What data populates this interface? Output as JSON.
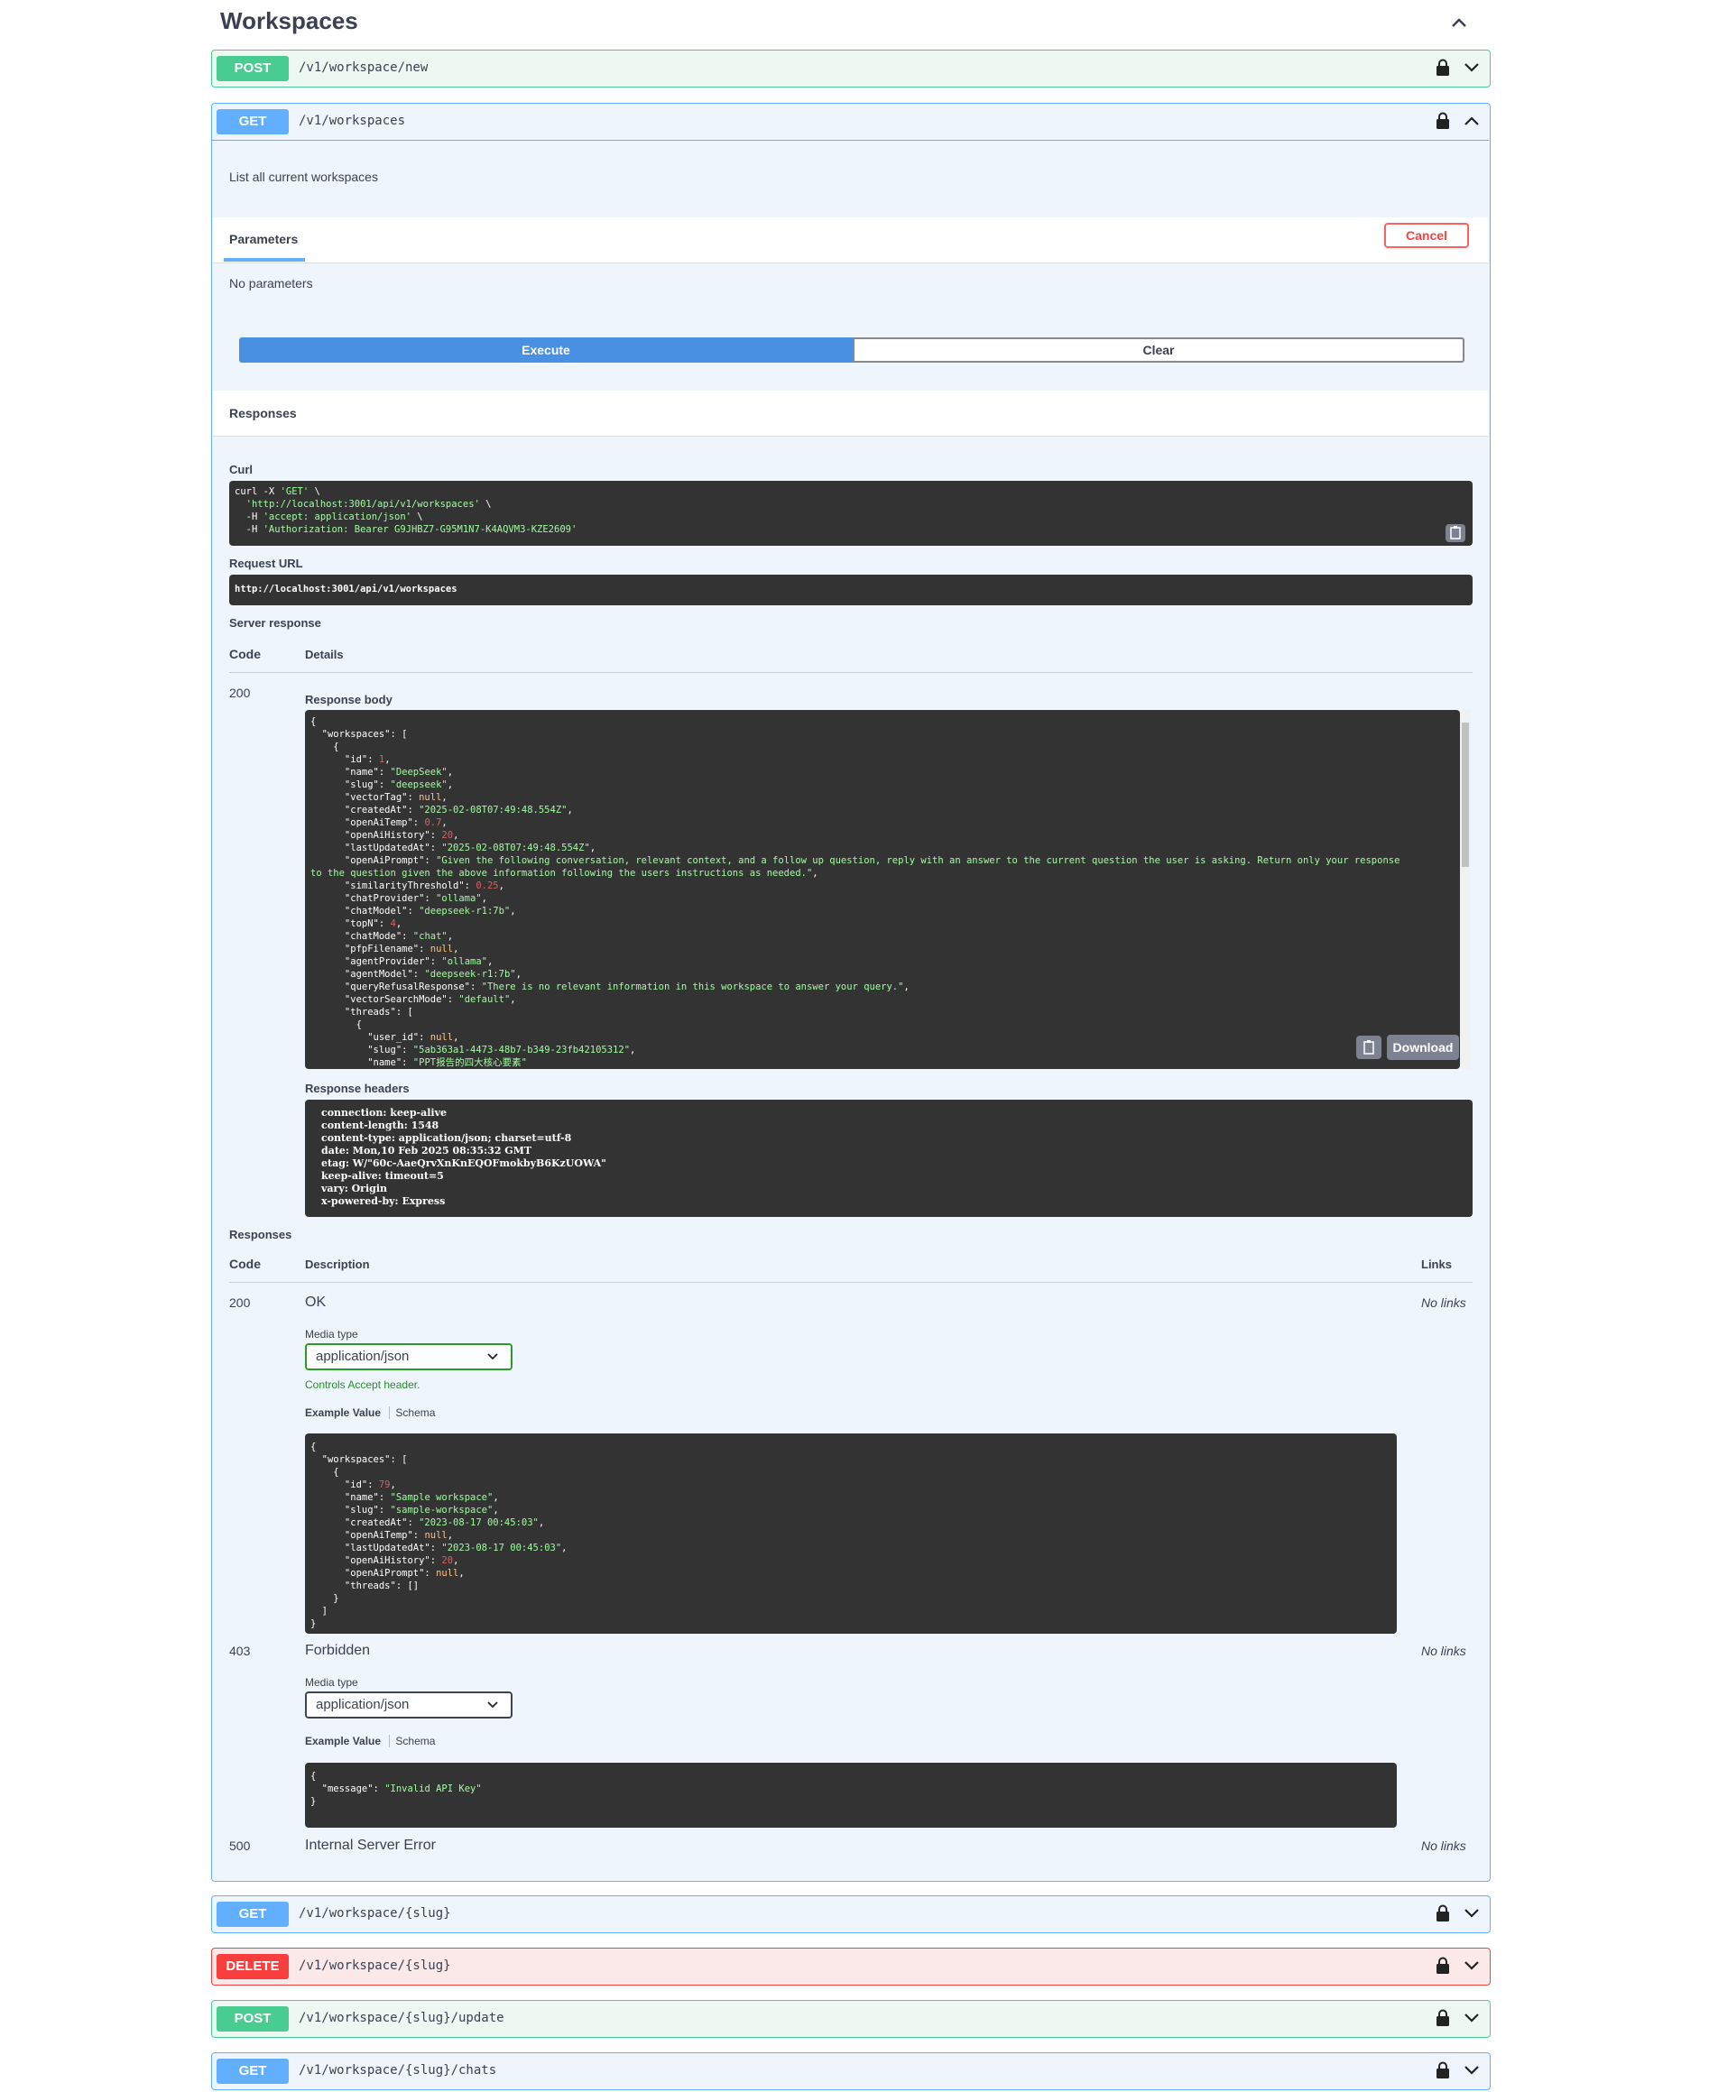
{
  "section": {
    "title": "Workspaces"
  },
  "ops": [
    {
      "method": "POST",
      "path": "/v1/workspace/new"
    },
    {
      "method": "GET",
      "path": "/v1/workspaces"
    },
    {
      "method": "GET",
      "path": "/v1/workspace/{slug}"
    },
    {
      "method": "DELETE",
      "path": "/v1/workspace/{slug}"
    },
    {
      "method": "POST",
      "path": "/v1/workspace/{slug}/update"
    },
    {
      "method": "GET",
      "path": "/v1/workspace/{slug}/chats"
    }
  ],
  "expanded": {
    "description": "List all current workspaces",
    "parameters_tab": "Parameters",
    "cancel_label": "Cancel",
    "no_parameters": "No parameters",
    "execute_label": "Execute",
    "clear_label": "Clear",
    "responses_heading": "Responses",
    "curl_label": "Curl",
    "curl_lines": [
      "curl -X 'GET' \\",
      "  'http://localhost:3001/api/v1/workspaces' \\",
      "  -H 'accept: application/json' \\",
      "  -H 'Authorization: Bearer G9JHBZ7-G95M1N7-K4AQVM3-KZE2609'"
    ],
    "request_url_label": "Request URL",
    "request_url": "http://localhost:3001/api/v1/workspaces",
    "server_response_label": "Server response",
    "code_header": "Code",
    "details_header": "Details",
    "server_code": "200",
    "response_body_label": "Response body",
    "download_label": "Download",
    "response_headers_label": "Response headers",
    "response_headers": [
      "connection: keep-alive",
      "content-length: 1548",
      "content-type: application/json; charset=utf-8",
      "date: Mon,10 Feb 2025 08:35:32 GMT",
      "etag: W/\"60c-AaeQrvXnKnEQOFmokbyB6KzUOWA\"",
      "keep-alive: timeout=5",
      "vary: Origin",
      "x-powered-by: Express"
    ],
    "responses2_label": "Responses",
    "description_header": "Description",
    "links_header": "Links",
    "media_type_label": "Media type",
    "media_type_value": "application/json",
    "controls_accept": "Controls Accept header.",
    "example_value_tab": "Example Value",
    "schema_tab": "Schema",
    "no_links": "No links",
    "resp_rows": [
      {
        "code": "200",
        "desc": "OK"
      },
      {
        "code": "403",
        "desc": "Forbidden"
      },
      {
        "code": "500",
        "desc": "Internal Server Error"
      }
    ]
  },
  "body_json_lines": [
    {
      "t": "{"
    },
    {
      "t": "  \"workspaces\": ["
    },
    {
      "t": "    {"
    },
    {
      "k": "      \"id\": ",
      "v": "1",
      "c": "num",
      "e": ","
    },
    {
      "k": "      \"name\": ",
      "v": "\"DeepSeek\"",
      "c": "str",
      "e": ","
    },
    {
      "k": "      \"slug\": ",
      "v": "\"deepseek\"",
      "c": "str",
      "e": ","
    },
    {
      "k": "      \"vectorTag\": ",
      "v": "null",
      "c": "kw",
      "e": ","
    },
    {
      "k": "      \"createdAt\": ",
      "v": "\"2025-02-08T07:49:48.554Z\"",
      "c": "str",
      "e": ","
    },
    {
      "k": "      \"openAiTemp\": ",
      "v": "0.7",
      "c": "num",
      "e": ","
    },
    {
      "k": "      \"openAiHistory\": ",
      "v": "20",
      "c": "num",
      "e": ","
    },
    {
      "k": "      \"lastUpdatedAt\": ",
      "v": "\"2025-02-08T07:49:48.554Z\"",
      "c": "str",
      "e": ","
    },
    {
      "k": "      \"openAiPrompt\": ",
      "v": "\"Given the following conversation, relevant context, and a follow up question, reply with an answer to the current question the user is asking. Return only your response",
      "c": "str",
      "e": ""
    },
    {
      "k": "",
      "v": "to the question given the above information following the users instructions as needed.\"",
      "c": "str",
      "e": ","
    },
    {
      "k": "      \"similarityThreshold\": ",
      "v": "0.25",
      "c": "num",
      "e": ","
    },
    {
      "k": "      \"chatProvider\": ",
      "v": "\"ollama\"",
      "c": "str",
      "e": ","
    },
    {
      "k": "      \"chatModel\": ",
      "v": "\"deepseek-r1:7b\"",
      "c": "str",
      "e": ","
    },
    {
      "k": "      \"topN\": ",
      "v": "4",
      "c": "num",
      "e": ","
    },
    {
      "k": "      \"chatMode\": ",
      "v": "\"chat\"",
      "c": "str",
      "e": ","
    },
    {
      "k": "      \"pfpFilename\": ",
      "v": "null",
      "c": "kw",
      "e": ","
    },
    {
      "k": "      \"agentProvider\": ",
      "v": "\"ollama\"",
      "c": "str",
      "e": ","
    },
    {
      "k": "      \"agentModel\": ",
      "v": "\"deepseek-r1:7b\"",
      "c": "str",
      "e": ","
    },
    {
      "k": "      \"queryRefusalResponse\": ",
      "v": "\"There is no relevant information in this workspace to answer your query.\"",
      "c": "str",
      "e": ","
    },
    {
      "k": "      \"vectorSearchMode\": ",
      "v": "\"default\"",
      "c": "str",
      "e": ","
    },
    {
      "t": "      \"threads\": ["
    },
    {
      "t": "        {"
    },
    {
      "k": "          \"user_id\": ",
      "v": "null",
      "c": "kw",
      "e": ","
    },
    {
      "k": "          \"slug\": ",
      "v": "\"5ab363a1-4473-48b7-b349-23fb42105312\"",
      "c": "str",
      "e": ","
    },
    {
      "k": "          \"name\": ",
      "v": "\"PPT报告的四大核心要素\"",
      "c": "str",
      "e": ""
    }
  ],
  "example1_lines": [
    {
      "t": "{"
    },
    {
      "t": "  \"workspaces\": ["
    },
    {
      "t": "    {"
    },
    {
      "k": "      \"id\": ",
      "v": "79",
      "c": "num",
      "e": ","
    },
    {
      "k": "      \"name\": ",
      "v": "\"Sample workspace\"",
      "c": "str",
      "e": ","
    },
    {
      "k": "      \"slug\": ",
      "v": "\"sample-workspace\"",
      "c": "str",
      "e": ","
    },
    {
      "k": "      \"createdAt\": ",
      "v": "\"2023-08-17 00:45:03\"",
      "c": "str",
      "e": ","
    },
    {
      "k": "      \"openAiTemp\": ",
      "v": "null",
      "c": "kw",
      "e": ","
    },
    {
      "k": "      \"lastUpdatedAt\": ",
      "v": "\"2023-08-17 00:45:03\"",
      "c": "str",
      "e": ","
    },
    {
      "k": "      \"openAiHistory\": ",
      "v": "20",
      "c": "num",
      "e": ","
    },
    {
      "k": "      \"openAiPrompt\": ",
      "v": "null",
      "c": "kw",
      "e": ","
    },
    {
      "t": "      \"threads\": []"
    },
    {
      "t": "    }"
    },
    {
      "t": "  ]"
    },
    {
      "t": "}"
    }
  ],
  "example2_lines": [
    {
      "t": "{"
    },
    {
      "k": "  \"message\": ",
      "v": "\"Invalid API Key\"",
      "c": "str",
      "e": ""
    },
    {
      "t": "}"
    }
  ]
}
